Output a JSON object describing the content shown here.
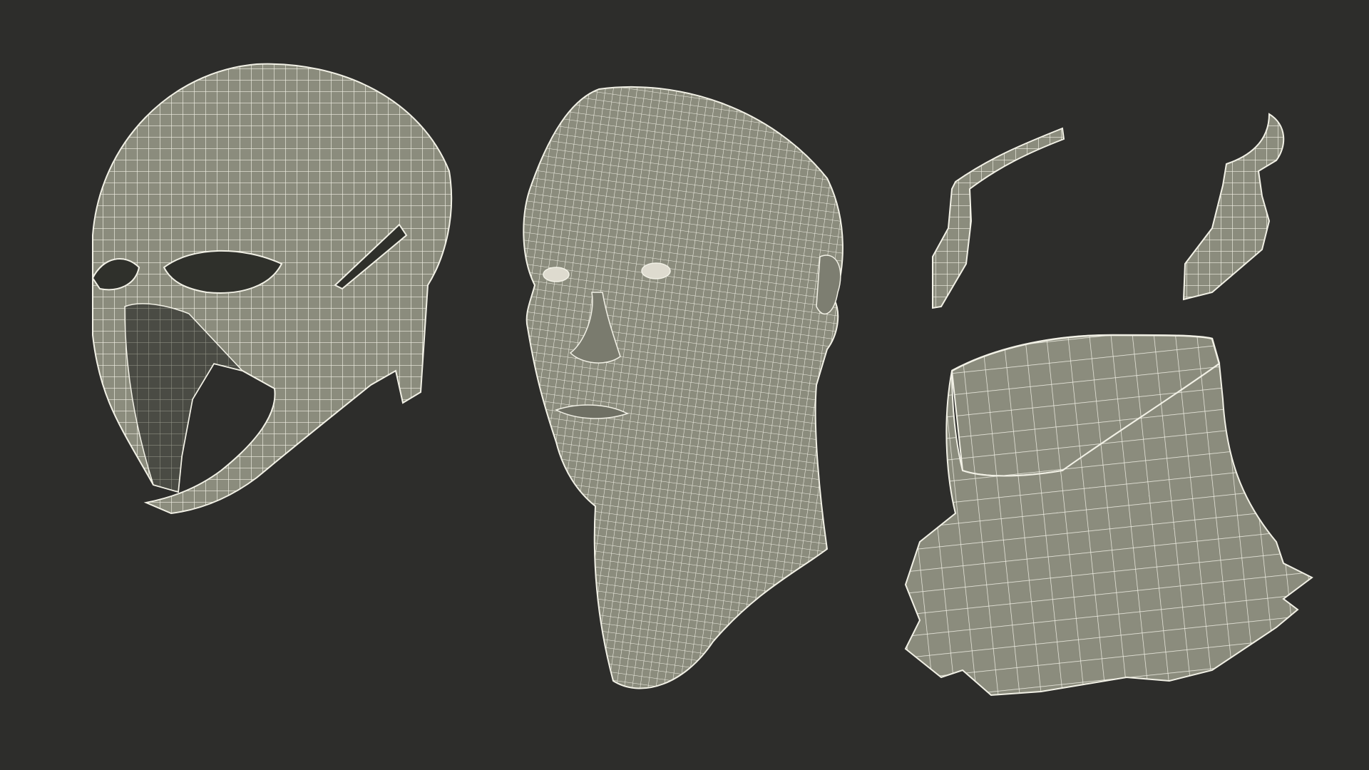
{
  "scene": {
    "background_color": "#2d2d2b",
    "mesh_fill_color": "#8b8c7d",
    "mesh_shadow_color": "#6e6f63",
    "mesh_inner_color": "#3a3b35",
    "wire_color": "#f2f1e6",
    "objects": [
      {
        "id": "mask",
        "icon": "wireframe-mask"
      },
      {
        "id": "head",
        "icon": "wireframe-head"
      },
      {
        "id": "horn-left",
        "icon": "wireframe-horn"
      },
      {
        "id": "horn-right",
        "icon": "wireframe-horn"
      },
      {
        "id": "collar",
        "icon": "wireframe-collar"
      }
    ]
  }
}
